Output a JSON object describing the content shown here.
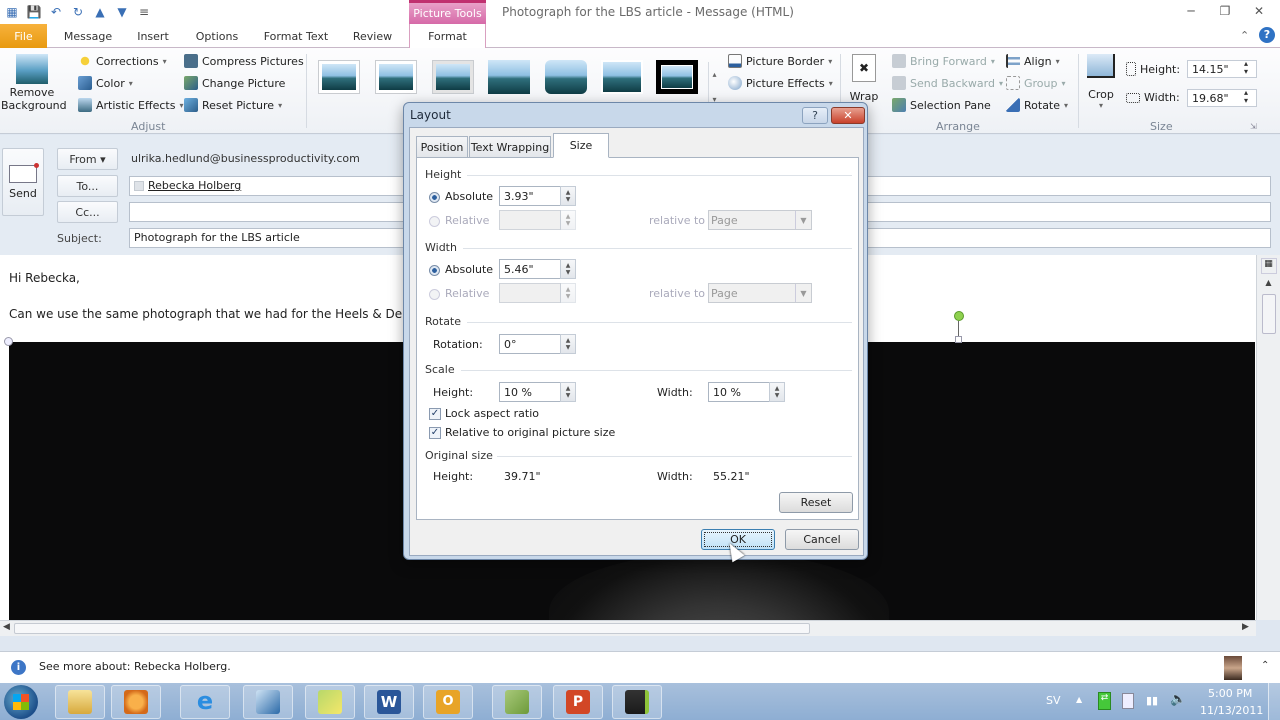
{
  "window": {
    "title": "Photograph for the LBS article  -  Message (HTML)",
    "context_tab_group": "Picture Tools",
    "minimize": "─",
    "restore": "❐",
    "close": "✕"
  },
  "qat": {
    "icons": [
      "save-icon",
      "undo-icon",
      "redo-icon",
      "up-icon",
      "down-icon",
      "customize-icon"
    ]
  },
  "tabs": [
    "File",
    "Message",
    "Insert",
    "Options",
    "Format Text",
    "Review",
    "Format"
  ],
  "ribbon": {
    "adjust": {
      "remove_background": "Remove Background",
      "corrections": "Corrections",
      "color": "Color",
      "artistic_effects": "Artistic Effects",
      "compress_pictures": "Compress Pictures",
      "change_picture": "Change Picture",
      "reset_picture": "Reset Picture",
      "label": "Adjust"
    },
    "styles": {
      "picture_border": "Picture Border",
      "picture_effects": "Picture Effects"
    },
    "arrange": {
      "wrap": "Wrap",
      "bring_forward": "Bring Forward",
      "send_backward": "Send Backward",
      "selection_pane": "Selection Pane",
      "align": "Align",
      "group": "Group",
      "rotate": "Rotate",
      "label": "Arrange"
    },
    "size": {
      "crop": "Crop",
      "height_label": "Height:",
      "height_value": "14.15\"",
      "width_label": "Width:",
      "width_value": "19.68\"",
      "label": "Size"
    }
  },
  "message": {
    "send_label": "Send",
    "from_label": "From ▾",
    "from_value": "ulrika.hedlund@businessproductivity.com",
    "to_label": "To...",
    "to_value": "Rebecka Holberg",
    "cc_label": "Cc...",
    "cc_value": "",
    "subject_label": "Subject:",
    "subject_value": "Photograph for the LBS article",
    "body_line1": "Hi Rebecka,",
    "body_line2": "Can we use the same photograph that we had for the Heels & De"
  },
  "infobar": {
    "text": "See more about: Rebecka Holberg."
  },
  "taskbar": {
    "apps": [
      "windows-explorer",
      "media-player",
      "internet-explorer",
      "lync",
      "sticky-notes",
      "word",
      "outlook",
      "publisher",
      "powerpoint",
      "camtasia"
    ],
    "language": "SV",
    "time": "5:00 PM",
    "date": "11/13/2011"
  },
  "dialog": {
    "title": "Layout",
    "help": "?",
    "close": "✕",
    "tabs": [
      "Position",
      "Text Wrapping",
      "Size"
    ],
    "active_tab": "Size",
    "height": {
      "section": "Height",
      "absolute_label": "Absolute",
      "absolute_value": "3.93\"",
      "relative_label": "Relative",
      "relative_value": "",
      "relative_to_label": "relative to",
      "relative_to_value": "Page"
    },
    "width": {
      "section": "Width",
      "absolute_label": "Absolute",
      "absolute_value": "5.46\"",
      "relative_label": "Relative",
      "relative_value": "",
      "relative_to_label": "relative to",
      "relative_to_value": "Page"
    },
    "rotate": {
      "section": "Rotate",
      "rotation_label": "Rotation:",
      "rotation_value": "0°"
    },
    "scale": {
      "section": "Scale",
      "height_label": "Height:",
      "height_value": "10 %",
      "width_label": "Width:",
      "width_value": "10 %",
      "lock_aspect": "Lock aspect ratio",
      "lock_aspect_checked": true,
      "relative_original": "Relative to original picture size",
      "relative_original_checked": true
    },
    "original_size": {
      "section": "Original size",
      "height_label": "Height:",
      "height_value": "39.71\"",
      "width_label": "Width:",
      "width_value": "55.21\""
    },
    "reset": "Reset",
    "ok": "OK",
    "cancel": "Cancel"
  }
}
